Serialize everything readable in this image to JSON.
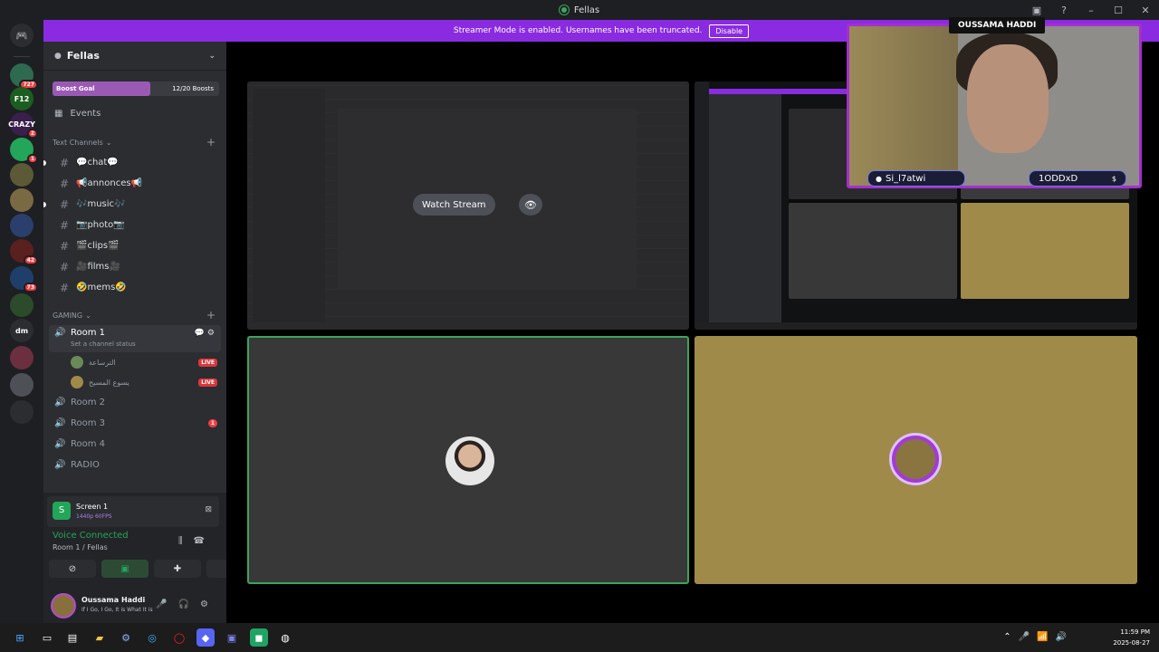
{
  "window": {
    "title": "Fellas"
  },
  "banner": {
    "text": "Streamer Mode is enabled. Usernames have been truncated.",
    "button": "Disable"
  },
  "rail": {
    "home_label": "DM",
    "servers": [
      {
        "label": "",
        "badge": "727",
        "color": "#2d6a4f"
      },
      {
        "label": "F12",
        "badge": "",
        "color": "#1b5e20"
      },
      {
        "label": "CRAZY",
        "badge": "2",
        "color": "#3a1f4d"
      },
      {
        "label": "",
        "badge": "1",
        "color": "#23a55a"
      },
      {
        "label": "",
        "badge": "",
        "color": "#5c5a36"
      },
      {
        "label": "",
        "badge": "",
        "color": "#7a6a44"
      },
      {
        "label": "",
        "badge": "",
        "color": "#2a3f6b"
      },
      {
        "label": "",
        "badge": "42",
        "color": "#5a1f1f"
      },
      {
        "label": "",
        "badge": "73",
        "color": "#1f3f6b"
      },
      {
        "label": "",
        "badge": "",
        "color": "#2b4b2b"
      },
      {
        "label": "dm",
        "badge": "",
        "color": "#2b2d31"
      },
      {
        "label": "",
        "badge": "",
        "color": "#6b2f3f"
      },
      {
        "label": "",
        "badge": "",
        "color": "#4e5058"
      },
      {
        "label": "",
        "badge": "",
        "color": "#2b2d31"
      }
    ]
  },
  "guild": {
    "name": "Fellas",
    "boost_goal": "Boost Goal",
    "boosts": "12/20 Boosts",
    "events": "Events"
  },
  "text_category": "Text Channels",
  "text_channels": [
    {
      "name": "💬chat💬",
      "unread": true
    },
    {
      "name": "📢annonces📢",
      "unread": false
    },
    {
      "name": "🎶music🎶",
      "unread": true
    },
    {
      "name": "📷photo📷",
      "unread": false
    },
    {
      "name": "🎬clips🎬",
      "unread": false
    },
    {
      "name": "🎥films🎥",
      "unread": false
    },
    {
      "name": "🤣mems🤣",
      "unread": false
    }
  ],
  "voice_category": "GAMING",
  "room1": {
    "name": "Room 1",
    "status": "Set a channel status"
  },
  "members": [
    {
      "name": "الترساعة",
      "live": "LIVE",
      "color": "#6a8a5a"
    },
    {
      "name": "يسوع المسيح",
      "live": "LIVE",
      "color": "#a08a4a"
    }
  ],
  "voice_channels": [
    {
      "name": "Room 2",
      "badge": ""
    },
    {
      "name": "Room 3",
      "badge": "1"
    },
    {
      "name": "Room 4",
      "badge": ""
    },
    {
      "name": "RADIO",
      "badge": ""
    }
  ],
  "panel": {
    "screen_title": "Screen 1",
    "screen_quality": "1440p 60FPS",
    "voice_connected": "Voice Connected",
    "voice_location": "Room 1 / Fellas"
  },
  "user": {
    "name": "Oussama Haddi",
    "status": "If I Go, I Go, It is What It is"
  },
  "stage": {
    "watch_stream": "Watch Stream"
  },
  "webcam": {
    "name": "OUSSAMA HADDI",
    "tag_left": "Si_l7atwi",
    "tag_right": "1ODDxD"
  },
  "taskbar": {
    "time": "11:59 PM",
    "date": "2025-08-27"
  }
}
